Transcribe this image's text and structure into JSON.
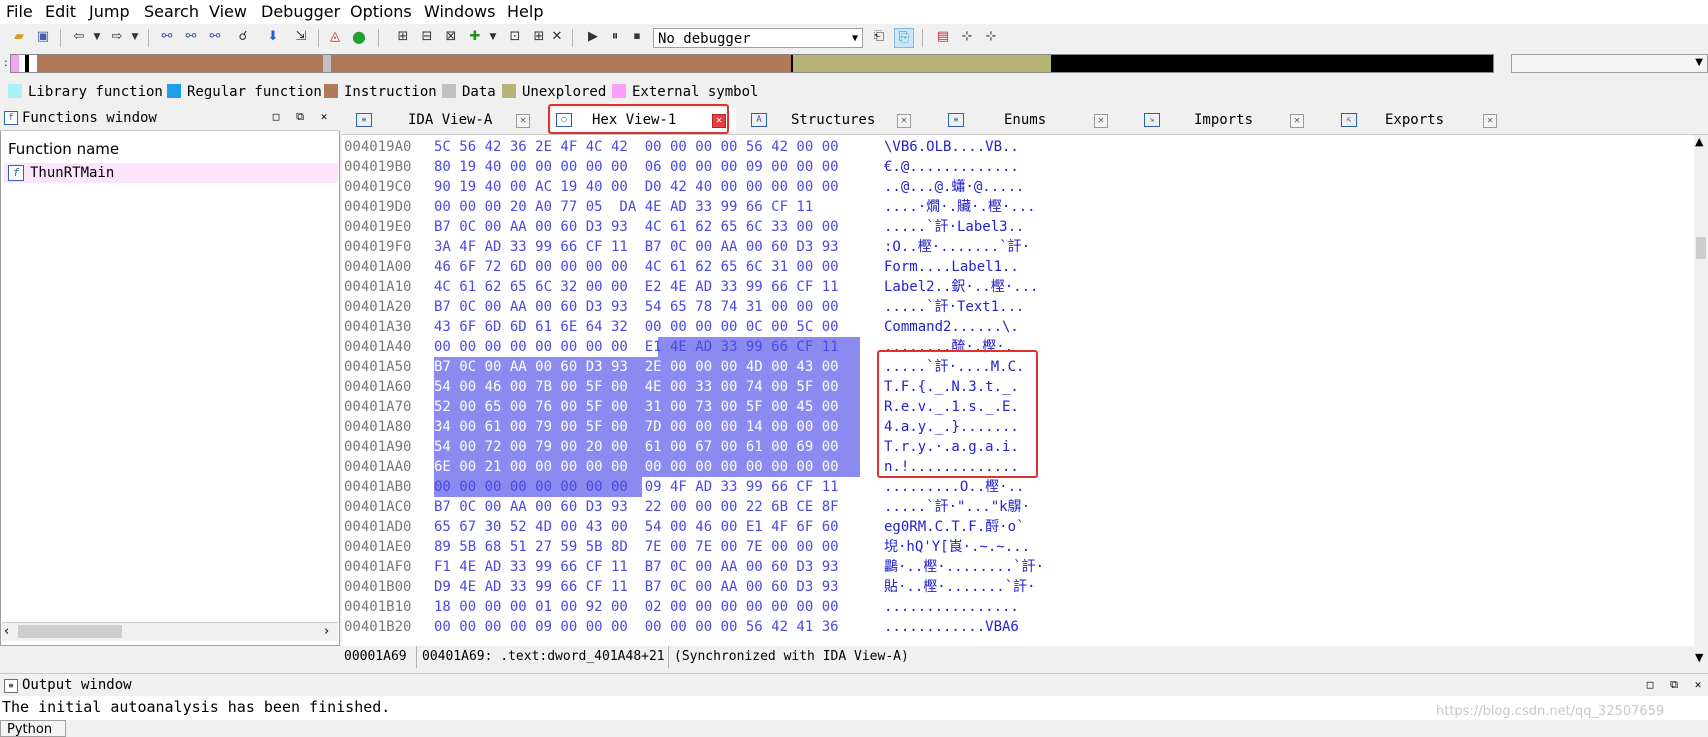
{
  "menu": [
    "File",
    "Edit",
    "Jump",
    "Search",
    "View",
    "Debugger",
    "Options",
    "Windows",
    "Help"
  ],
  "toolbar": {
    "debugger_select": "No debugger"
  },
  "legend": [
    {
      "label": "Library function",
      "color": "#aaf0f8"
    },
    {
      "label": "Regular function",
      "color": "#1ea0e8"
    },
    {
      "label": "Instruction",
      "color": "#b07a5a"
    },
    {
      "label": "Data",
      "color": "#c0c0c0"
    },
    {
      "label": "Unexplored",
      "color": "#b8b478"
    },
    {
      "label": "External symbol",
      "color": "#f8a0f8"
    }
  ],
  "functions_window": {
    "title": "Functions window",
    "column_header": "Function name",
    "items": [
      {
        "name": "ThunRTMain",
        "icon": "function-icon"
      }
    ]
  },
  "tabs": [
    {
      "label": "IDA View-A",
      "icon": "ida-view-icon"
    },
    {
      "label": "Hex View-1",
      "icon": "hex-view-icon",
      "active": true
    },
    {
      "label": "Structures",
      "icon": "structures-icon"
    },
    {
      "label": "Enums",
      "icon": "enums-icon"
    },
    {
      "label": "Imports",
      "icon": "imports-icon"
    },
    {
      "label": "Exports",
      "icon": "exports-icon"
    }
  ],
  "hex_lines": [
    {
      "addr": "004019A0",
      "hex1": "5C 56 42 36 2E 4F 4C 42",
      "hex2": "00 00 00 00 56 42 00 00",
      "ascii": "\\VB6.OLB....VB.."
    },
    {
      "addr": "004019B0",
      "hex1": "80 19 40 00 00 00 00 00",
      "hex2": "06 00 00 00 09 00 00 00",
      "ascii": "€.@............."
    },
    {
      "addr": "004019C0",
      "hex1": "90 19 40 00 AC 19 40 00",
      "hex2": "D0 42 40 00 00 00 00 00",
      "ascii": "..@...@.蠨·@....."
    },
    {
      "addr": "004019D0",
      "hex1": "00 00 00 20 A0 77 05",
      "hex2": "DA 4E AD 33 99 66 CF 11",
      "ascii": "....·燗·.贜·.樫·..."
    },
    {
      "addr": "004019E0",
      "hex1": "B7 0C 00 AA 00 60 D3 93",
      "hex2": "4C 61 62 65 6C 33 00 00",
      "ascii": ".....`訐·Label3.."
    },
    {
      "addr": "004019F0",
      "hex1": "3A 4F AD 33 99 66 CF 11",
      "hex2": "B7 0C 00 AA 00 60 D3 93",
      "ascii": ":O..樫·.......`訐·"
    },
    {
      "addr": "00401A00",
      "hex1": "46 6F 72 6D 00 00 00 00",
      "hex2": "4C 61 62 65 6C 31 00 00",
      "ascii": "Form....Label1.."
    },
    {
      "addr": "00401A10",
      "hex1": "4C 61 62 65 6C 32 00 00",
      "hex2": "E2 4E AD 33 99 66 CF 11",
      "ascii": "Label2..鈬·..樫·..."
    },
    {
      "addr": "00401A20",
      "hex1": "B7 0C 00 AA 00 60 D3 93",
      "hex2": "54 65 78 74 31 00 00 00",
      "ascii": ".....`訐·Text1..."
    },
    {
      "addr": "00401A30",
      "hex1": "43 6F 6D 6D 61 6E 64 32",
      "hex2": "00 00 00 00 0C 00 5C 00",
      "ascii": "Command2......\\."
    },
    {
      "addr": "00401A40",
      "hex1": "00 00 00 00 00 00 00 00",
      "hex2": "E1 4E AD 33 99 66 CF 11",
      "ascii": "........酼·.樫·."
    },
    {
      "addr": "00401A50",
      "hex1": "B7 0C 00 AA 00 60 D3 93",
      "hex2": "2E 00 00 00 4D 00 43 00",
      "ascii": ".....`訐·....M.C."
    },
    {
      "addr": "00401A60",
      "hex1": "54 00 46 00 7B 00 5F 00",
      "hex2": "4E 00 33 00 74 00 5F 00",
      "ascii": "T.F.{._.N.3.t._."
    },
    {
      "addr": "00401A70",
      "hex1": "52 00 65 00 76 00 5F 00",
      "hex2": "31 00 73 00 5F 00 45 00",
      "ascii": "R.e.v._.1.s._.E."
    },
    {
      "addr": "00401A80",
      "hex1": "34 00 61 00 79 00 5F 00",
      "hex2": "7D 00 00 00 14 00 00 00",
      "ascii": "4.a.y._.}......."
    },
    {
      "addr": "00401A90",
      "hex1": "54 00 72 00 79 00 20 00",
      "hex2": "61 00 67 00 61 00 69 00",
      "ascii": "T.r.y.·.a.g.a.i."
    },
    {
      "addr": "00401AA0",
      "hex1": "6E 00 21 00 00 00 00 00",
      "hex2": "00 00 00 00 00 00 00 00",
      "ascii": "n.!............."
    },
    {
      "addr": "00401AB0",
      "hex1": "00 00 00 00 00 00 00 00",
      "hex2": "09 4F AD 33 99 66 CF 11",
      "ascii": ".........O..樫·.."
    },
    {
      "addr": "00401AC0",
      "hex1": "B7 0C 00 AA 00 60 D3 93",
      "hex2": "22 00 00 00 22 6B CE 8F",
      "ascii": ".....`訐·\"...\"k鵿·"
    },
    {
      "addr": "00401AD0",
      "hex1": "65 67 30 52 4D 00 43 00",
      "hex2": "54 00 46 00 E1 4F 6F 60",
      "ascii": "eg0RM.C.T.F.酹·o`"
    },
    {
      "addr": "00401AE0",
      "hex1": "89 5B 68 51 27 59 5B 8D",
      "hex2": "7E 00 7E 00 7E 00 00 00",
      "ascii": "堄·hQ'Y[崀·.~.~..."
    },
    {
      "addr": "00401AF0",
      "hex1": "F1 4E AD 33 99 66 CF 11",
      "hex2": "B7 0C 00 AA 00 60 D3 93",
      "ascii": "鸓·..樫·........`訐·"
    },
    {
      "addr": "00401B00",
      "hex1": "D9 4E AD 33 99 66 CF 11",
      "hex2": "B7 0C 00 AA 00 60 D3 93",
      "ascii": "貼·..樫·.......`訐·"
    },
    {
      "addr": "00401B10",
      "hex1": "18 00 00 00 01 00 92 00",
      "hex2": "02 00 00 00 00 00 00 00",
      "ascii": "................"
    },
    {
      "addr": "00401B20",
      "hex1": "00 00 00 00 09 00 00 00",
      "hex2": "00 00 00 00 56 42 41 36",
      "ascii": "............VBA6"
    }
  ],
  "hex_status": {
    "offset": "00001A69",
    "location": "00401A69: .text:dword_401A48+21",
    "sync": "(Synchronized with IDA View-A)"
  },
  "output_window": {
    "title": "Output window",
    "message": "The initial autoanalysis has been finished.",
    "python_button": "Python"
  },
  "watermark": "https://blog.csdn.net/qq_32507659"
}
